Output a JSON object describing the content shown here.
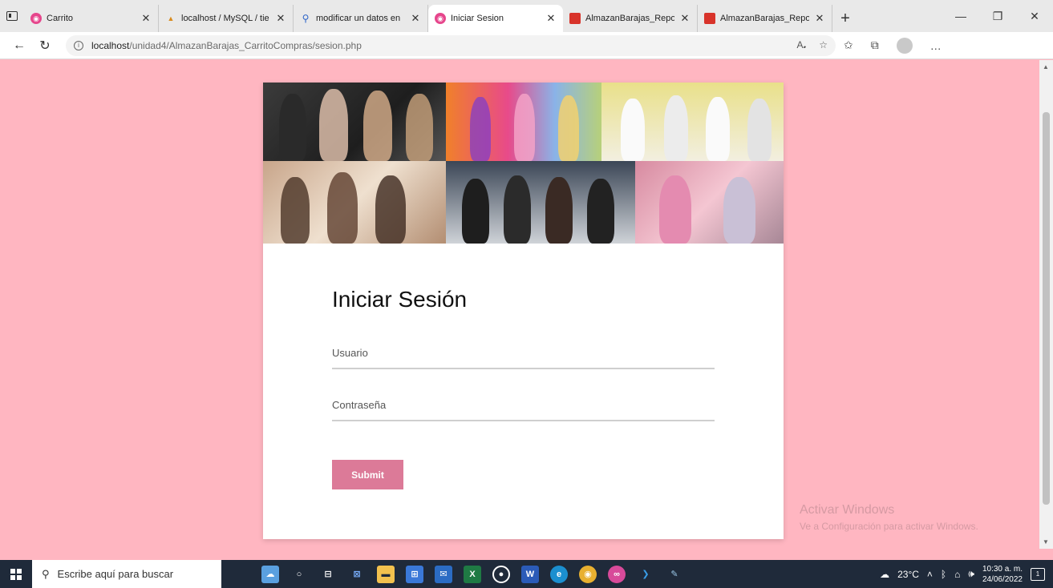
{
  "browser": {
    "tabs": [
      {
        "label": "Carrito",
        "icon": "site-logo-icon",
        "active": false
      },
      {
        "label": "localhost / MySQL / tie",
        "icon": "phpmyadmin-icon",
        "active": false
      },
      {
        "label": "modificar un datos en",
        "icon": "search-icon",
        "active": false
      },
      {
        "label": "Iniciar Sesion",
        "icon": "site-logo-icon",
        "active": true
      },
      {
        "label": "AlmazanBarajas_Repor",
        "icon": "pdf-icon",
        "active": false
      },
      {
        "label": "AlmazanBarajas_Repo",
        "icon": "pdf-icon",
        "active": false
      }
    ],
    "url_host": "localhost",
    "url_path": "/unidad4/AlmazanBarajas_CarritoCompras/sesion.php"
  },
  "page": {
    "title": "Iniciar Sesión",
    "username_placeholder": "Usuario",
    "password_placeholder": "Contraseña",
    "submit_label": "Submit"
  },
  "watermark": {
    "line1": "Activar Windows",
    "line2": "Ve a Configuración para activar Windows."
  },
  "taskbar": {
    "search_placeholder": "Escribe aquí para buscar",
    "temperature": "23°C",
    "time": "10:30 a. m.",
    "date": "24/06/2022"
  },
  "colors": {
    "page_background": "#ffb6c1",
    "submit_button": "#dc7a98"
  }
}
